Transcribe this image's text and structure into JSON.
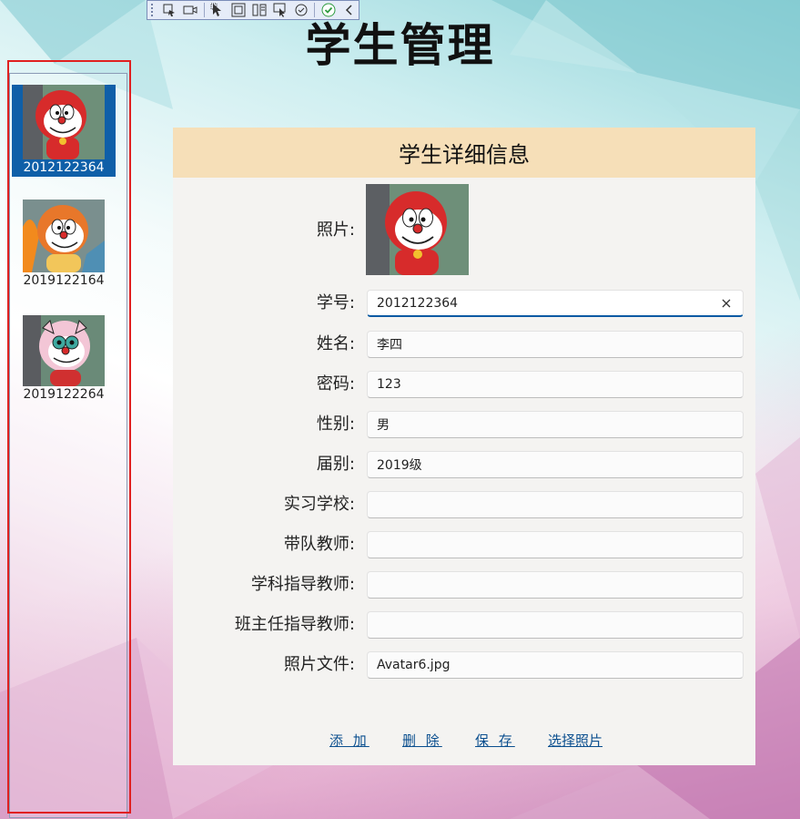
{
  "toolbar": {
    "icons": [
      "select-element-icon",
      "record-video-icon",
      "pointer-icon",
      "layout-adorner-icon",
      "hot-reload-icon",
      "track-focus-icon",
      "binding-failures-icon",
      "check-icon",
      "collapse-chevron-icon"
    ]
  },
  "page": {
    "title": "学生管理"
  },
  "students": [
    {
      "id": "2012122364",
      "selected": true
    },
    {
      "id": "2019122164",
      "selected": false
    },
    {
      "id": "2019122264",
      "selected": false
    }
  ],
  "detail": {
    "header": "学生详细信息",
    "photo_label": "照片:",
    "fields": [
      {
        "label": "学号:",
        "value": "2012122364"
      },
      {
        "label": "姓名:",
        "value": "李四"
      },
      {
        "label": "密码:",
        "value": "123"
      },
      {
        "label": "性别:",
        "value": "男"
      },
      {
        "label": "届别:",
        "value": "2019级"
      },
      {
        "label": "实习学校:",
        "value": ""
      },
      {
        "label": "带队教师:",
        "value": ""
      },
      {
        "label": "学科指导教师:",
        "value": ""
      },
      {
        "label": "班主任指导教师:",
        "value": ""
      },
      {
        "label": "照片文件:",
        "value": "Avatar6.jpg"
      }
    ]
  },
  "actions": {
    "add": "添 加",
    "delete": "删 除",
    "save": "保 存",
    "choose_photo": "选择照片"
  },
  "colors": {
    "selected": "#0f5fa8",
    "header": "#f6dfb8",
    "link": "#0b4f8f",
    "focus": "#0b5aa3",
    "frame": "#e02020"
  }
}
